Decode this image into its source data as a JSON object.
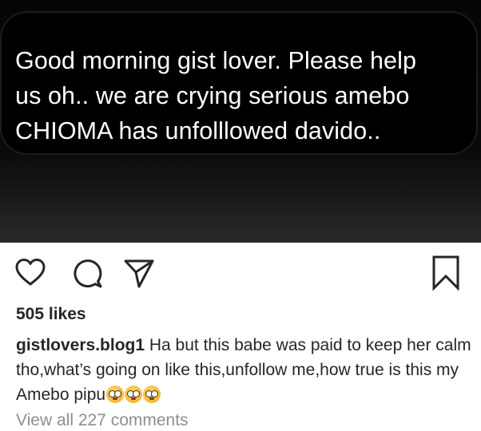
{
  "post_image": {
    "message_lines": [
      "Good morning gist lover. Please help",
      "us oh.. we are crying serious amebo",
      "CHIOMA has unfolllowed davido.."
    ]
  },
  "actions": {
    "icons": [
      "heart-icon",
      "comment-icon",
      "share-icon",
      "bookmark-icon"
    ]
  },
  "likes": "505 likes",
  "caption": {
    "username": "gistlovers.blog1",
    "text": " Ha but this babe was paid to keep her calm tho,what’s going on like this,unfollow me,how true is this my Amebo pipu",
    "emojis": [
      "flushed-face",
      "flushed-face",
      "flushed-face"
    ]
  },
  "comments": {
    "view_all": "View all 227 comments"
  }
}
